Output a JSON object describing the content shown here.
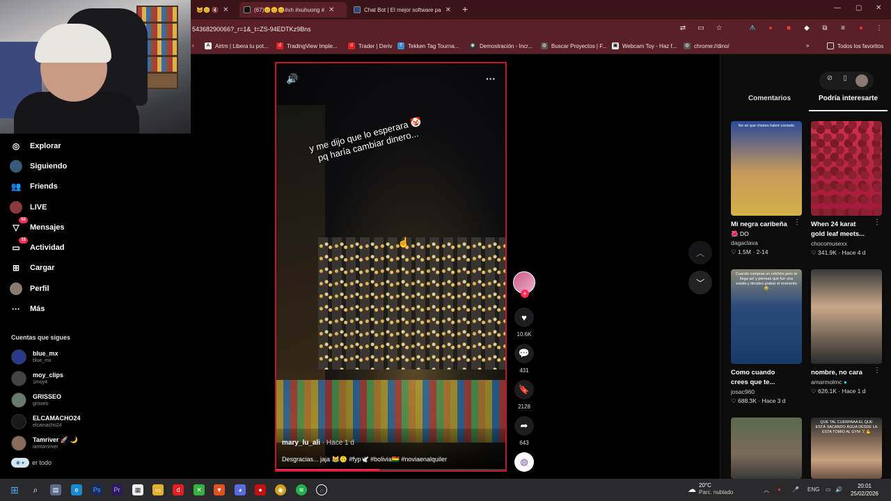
{
  "browser": {
    "tabs": [
      {
        "label": "",
        "active": false
      },
      {
        "label": "(67)😊😊😊#xh #xuhuong #",
        "active": true
      },
      {
        "label": "Chat Bot | El mejor software pa",
        "active": false
      }
    ],
    "url": "54368290066?_r=1&_t=ZS-94EDTKz9Bns",
    "bookmarks": [
      "Airtm | Libera tu pot...",
      "TradingView Imple...",
      "Trader | Deriv",
      "Tekken Tag Tourna...",
      "Demostración - Incr...",
      "Buscar Proyectos | F...",
      "Webcam Toy - Haz f...",
      "chrome://dino/"
    ],
    "bookmarks_folder": "Todos los favoritos",
    "accent": "#5a2027"
  },
  "sidebar": {
    "nav": [
      {
        "label": "Explorar",
        "icon": "compass-icon"
      },
      {
        "label": "Siguiendo",
        "icon": "following-icon"
      },
      {
        "label": "Friends",
        "icon": "friends-icon"
      },
      {
        "label": "LIVE",
        "icon": "live-icon"
      },
      {
        "label": "Mensajes",
        "icon": "messages-icon",
        "badge": "52"
      },
      {
        "label": "Actividad",
        "icon": "activity-icon",
        "badge": "15"
      },
      {
        "label": "Cargar",
        "icon": "upload-icon"
      },
      {
        "label": "Perfil",
        "icon": "profile-icon"
      },
      {
        "label": "Más",
        "icon": "more-icon"
      }
    ],
    "following_title": "Cuentas que sigues",
    "following": [
      {
        "name": "blue_mx",
        "handle": "blue_mx"
      },
      {
        "name": "moy_clips",
        "handle": "1moy4"
      },
      {
        "name": "GRISSEO",
        "handle": "grisseo"
      },
      {
        "name": "ELCAMACHO24",
        "handle": "elcamacho24"
      },
      {
        "name": "Tamriver 🚀 🌙",
        "handle": "iamtamriver"
      }
    ],
    "see_all": "er todo"
  },
  "video": {
    "caption_line1": "y me dijo que lo esperara 🤡",
    "caption_line2": "pq haría cambiar dinero...",
    "author": "mary_lu_ali",
    "posted": "· Hace 1 d",
    "description": "Desgracias... jaja 😹🙃 #fyp🕊️ #bolivia🇧🇴 #noviaenalquiler",
    "progress": 0.45
  },
  "actions": {
    "likes": "10.6K",
    "comments": "431",
    "saves": "2128",
    "shares": "643"
  },
  "right_panel": {
    "tabs": [
      "Comentarios",
      "Podría interesarte"
    ],
    "selected_tab": "Podría interesarte",
    "cards": [
      {
        "title": "Mi negra caribeña",
        "sub": "🌺 DO",
        "author": "dagaclava",
        "likes": "1.5M",
        "time": "2-14",
        "overlay": "No sé que chistes habré contado",
        "color": "#3a5fa8"
      },
      {
        "title": "When 24 karat",
        "sub": "gold leaf meets...",
        "author": "chocomusexx",
        "likes": "341.9K",
        "time": "Hace 4 d",
        "overlay": "",
        "color": "#c0264a"
      },
      {
        "title": "Como cuando",
        "sub": "crees que te...",
        "author": "josac960",
        "likes": "688.3K",
        "time": "Hace 3 d",
        "overlay": "Cuando compras un colchón pero te llega así y piensas que fue una estafa y decides grabar el momento 😂",
        "color": "#3c5f8a"
      },
      {
        "title": "nombre, no cara",
        "sub": "",
        "author": "amarmolmc",
        "likes": "626.1K",
        "time": "Hace 1 d",
        "overlay": "",
        "color": "#6a5040"
      },
      {
        "title": "",
        "sub": "",
        "author": "",
        "likes": "",
        "time": "",
        "overlay": "",
        "color": "#4a5a3a"
      },
      {
        "title": "",
        "sub": "",
        "author": "",
        "likes": "",
        "time": "",
        "overlay": "QUE TAL CUERPAAA EL QUE ESTÁ SACANDO ÁGUA DESDE LA ESTA TOMIO AL GYM 🏋️💪",
        "color": "#3a3a3a"
      }
    ]
  },
  "taskbar": {
    "weather_temp": "20°C",
    "weather_desc": "Parc. nublado",
    "lang": "ENG",
    "time": "20:01",
    "date": "25/02/2026"
  }
}
